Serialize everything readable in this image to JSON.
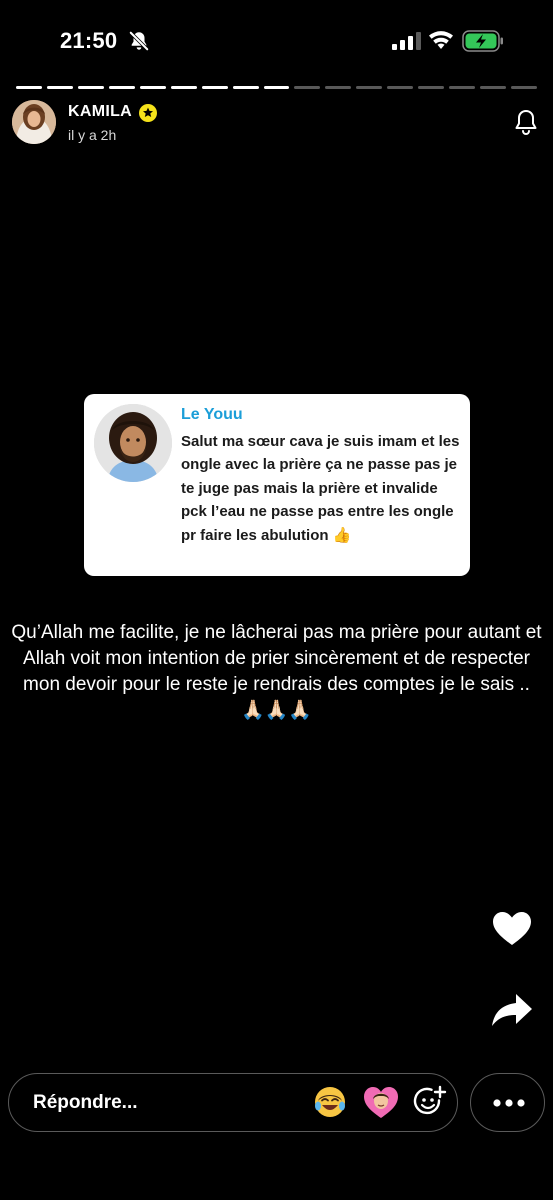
{
  "status_bar": {
    "time": "21:50",
    "icons": [
      "bell-slash-icon",
      "cellular-signal-icon",
      "wifi-icon",
      "battery-charging-icon"
    ],
    "battery_color": "#34c759"
  },
  "progress": {
    "total_segments": 17,
    "viewed_segments": 9
  },
  "story_header": {
    "user_name": "KAMILA",
    "badge_icon": "star-badge-icon",
    "badge_color": "#f5e21a",
    "time_ago": "il y a 2h",
    "notification_icon": "bell-icon"
  },
  "question_card": {
    "author": "Le Youu",
    "author_color": "#1b9ed8",
    "text": "Salut ma sœur cava je suis imam et les ongle avec la prière ça ne passe pas je te juge pas mais la prière et invalide pck l’eau ne passe pas entre les ongle pr faire les abulution 👍"
  },
  "caption": {
    "text": "Qu’Allah me facilite, je ne lâcherai pas ma prière pour autant et Allah voit mon intention de prier sincèrement et de respecter mon devoir pour le reste je rendrais des comptes je le sais .. 🙏🏻🙏🏻🙏🏻"
  },
  "actions": {
    "like_icon": "heart-icon",
    "share_icon": "share-arrow-icon"
  },
  "reply_bar": {
    "placeholder": "Répondre...",
    "quick_reactions": [
      "crying-laughing-face-icon",
      "heart-face-icon"
    ],
    "add_reaction_icon": "add-emoji-icon",
    "more_icon": "more-dots-icon"
  }
}
